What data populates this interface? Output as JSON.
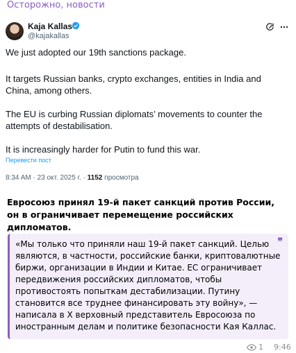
{
  "channel": {
    "title": "Осторожно, новости"
  },
  "tweet": {
    "author_name": "Kaja Kallas",
    "author_handle": "@kajakallas",
    "paragraphs": [
      "We just adopted our 19th sanctions package.",
      "It targets Russian banks, crypto exchanges, entities in India and China, among others.",
      "The EU is curbing Russian diplomats’ movements to counter the attempts of destabilisation.",
      "It is increasingly harder for Putin to fund this war."
    ],
    "translate_label": "Перевести пост",
    "timestamp": "8:34 AM · 23 окт. 2025 г. · ",
    "views_count": "1152",
    "views_label": " просмотра"
  },
  "post": {
    "headline": "Евросоюз принял 19-й пакет санкций против России, он в ограничивает перемещение российских дипломатов.",
    "quote": "«Мы только что приняли наш 19-й пакет санкций. Целью являются, в частности, российские банки, криптовалютные биржи, организации в Индии и Китае. ЕС ограничивает передвижения российских дипломатов, чтобы противостоять попыткам дестабилизации. Путину становится все труднее финансировать эту войну», — написала в X верховный представитель Евросоюза по иностранным делам и политике безопасности Кая Каллас.",
    "quote_mark": "❞",
    "views": "1",
    "time": "9:46"
  },
  "colors": {
    "accent": "#8b5fbf",
    "link": "#1d9bf0",
    "verified": "#1d9bf0"
  },
  "icons": [
    "verified-icon",
    "grok-icon",
    "more-icon",
    "quote-icon",
    "eye-icon"
  ]
}
